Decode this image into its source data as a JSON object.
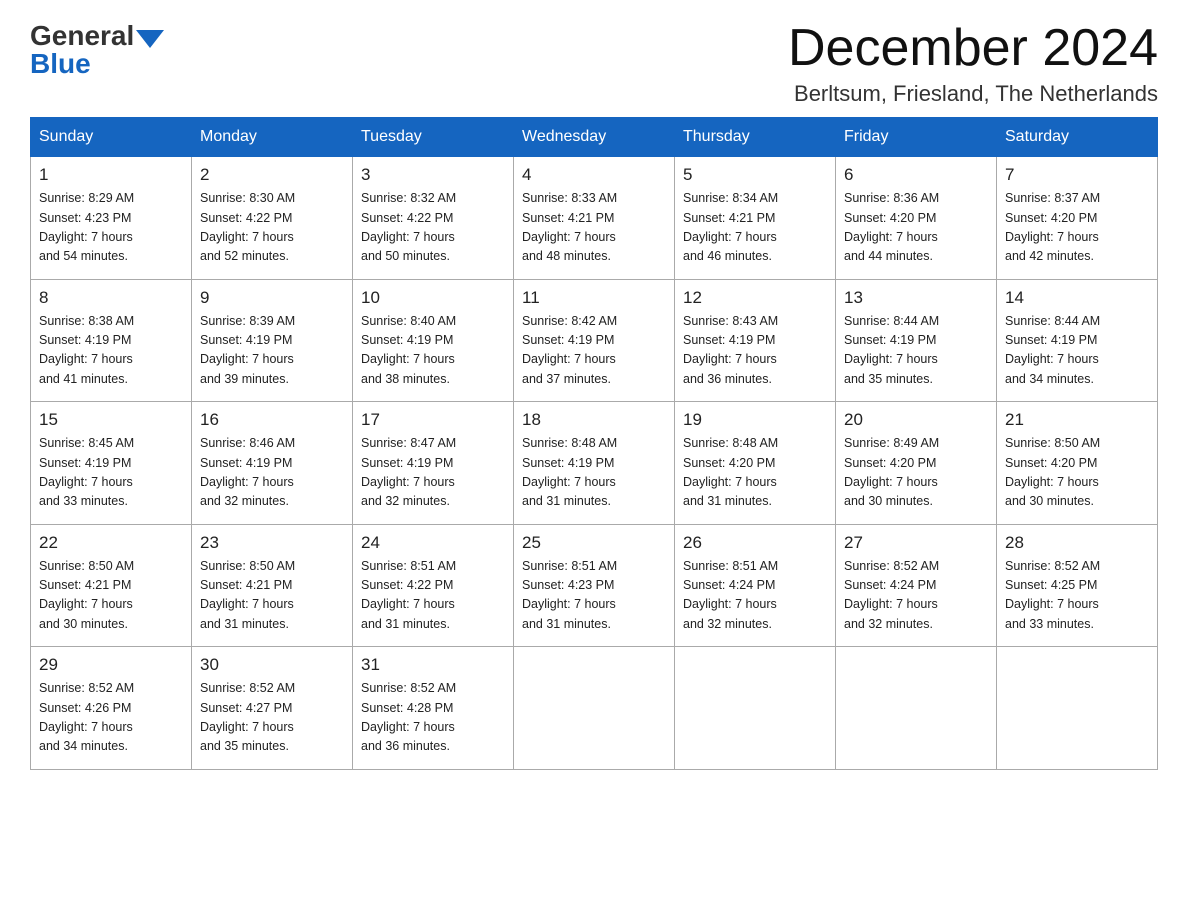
{
  "header": {
    "logo_general": "General",
    "logo_blue": "Blue",
    "month_title": "December 2024",
    "location": "Berltsum, Friesland, The Netherlands"
  },
  "days_of_week": [
    "Sunday",
    "Monday",
    "Tuesday",
    "Wednesday",
    "Thursday",
    "Friday",
    "Saturday"
  ],
  "weeks": [
    [
      {
        "day": "1",
        "sunrise": "8:29 AM",
        "sunset": "4:23 PM",
        "daylight": "7 hours and 54 minutes."
      },
      {
        "day": "2",
        "sunrise": "8:30 AM",
        "sunset": "4:22 PM",
        "daylight": "7 hours and 52 minutes."
      },
      {
        "day": "3",
        "sunrise": "8:32 AM",
        "sunset": "4:22 PM",
        "daylight": "7 hours and 50 minutes."
      },
      {
        "day": "4",
        "sunrise": "8:33 AM",
        "sunset": "4:21 PM",
        "daylight": "7 hours and 48 minutes."
      },
      {
        "day": "5",
        "sunrise": "8:34 AM",
        "sunset": "4:21 PM",
        "daylight": "7 hours and 46 minutes."
      },
      {
        "day": "6",
        "sunrise": "8:36 AM",
        "sunset": "4:20 PM",
        "daylight": "7 hours and 44 minutes."
      },
      {
        "day": "7",
        "sunrise": "8:37 AM",
        "sunset": "4:20 PM",
        "daylight": "7 hours and 42 minutes."
      }
    ],
    [
      {
        "day": "8",
        "sunrise": "8:38 AM",
        "sunset": "4:19 PM",
        "daylight": "7 hours and 41 minutes."
      },
      {
        "day": "9",
        "sunrise": "8:39 AM",
        "sunset": "4:19 PM",
        "daylight": "7 hours and 39 minutes."
      },
      {
        "day": "10",
        "sunrise": "8:40 AM",
        "sunset": "4:19 PM",
        "daylight": "7 hours and 38 minutes."
      },
      {
        "day": "11",
        "sunrise": "8:42 AM",
        "sunset": "4:19 PM",
        "daylight": "7 hours and 37 minutes."
      },
      {
        "day": "12",
        "sunrise": "8:43 AM",
        "sunset": "4:19 PM",
        "daylight": "7 hours and 36 minutes."
      },
      {
        "day": "13",
        "sunrise": "8:44 AM",
        "sunset": "4:19 PM",
        "daylight": "7 hours and 35 minutes."
      },
      {
        "day": "14",
        "sunrise": "8:44 AM",
        "sunset": "4:19 PM",
        "daylight": "7 hours and 34 minutes."
      }
    ],
    [
      {
        "day": "15",
        "sunrise": "8:45 AM",
        "sunset": "4:19 PM",
        "daylight": "7 hours and 33 minutes."
      },
      {
        "day": "16",
        "sunrise": "8:46 AM",
        "sunset": "4:19 PM",
        "daylight": "7 hours and 32 minutes."
      },
      {
        "day": "17",
        "sunrise": "8:47 AM",
        "sunset": "4:19 PM",
        "daylight": "7 hours and 32 minutes."
      },
      {
        "day": "18",
        "sunrise": "8:48 AM",
        "sunset": "4:19 PM",
        "daylight": "7 hours and 31 minutes."
      },
      {
        "day": "19",
        "sunrise": "8:48 AM",
        "sunset": "4:20 PM",
        "daylight": "7 hours and 31 minutes."
      },
      {
        "day": "20",
        "sunrise": "8:49 AM",
        "sunset": "4:20 PM",
        "daylight": "7 hours and 30 minutes."
      },
      {
        "day": "21",
        "sunrise": "8:50 AM",
        "sunset": "4:20 PM",
        "daylight": "7 hours and 30 minutes."
      }
    ],
    [
      {
        "day": "22",
        "sunrise": "8:50 AM",
        "sunset": "4:21 PM",
        "daylight": "7 hours and 30 minutes."
      },
      {
        "day": "23",
        "sunrise": "8:50 AM",
        "sunset": "4:21 PM",
        "daylight": "7 hours and 31 minutes."
      },
      {
        "day": "24",
        "sunrise": "8:51 AM",
        "sunset": "4:22 PM",
        "daylight": "7 hours and 31 minutes."
      },
      {
        "day": "25",
        "sunrise": "8:51 AM",
        "sunset": "4:23 PM",
        "daylight": "7 hours and 31 minutes."
      },
      {
        "day": "26",
        "sunrise": "8:51 AM",
        "sunset": "4:24 PM",
        "daylight": "7 hours and 32 minutes."
      },
      {
        "day": "27",
        "sunrise": "8:52 AM",
        "sunset": "4:24 PM",
        "daylight": "7 hours and 32 minutes."
      },
      {
        "day": "28",
        "sunrise": "8:52 AM",
        "sunset": "4:25 PM",
        "daylight": "7 hours and 33 minutes."
      }
    ],
    [
      {
        "day": "29",
        "sunrise": "8:52 AM",
        "sunset": "4:26 PM",
        "daylight": "7 hours and 34 minutes."
      },
      {
        "day": "30",
        "sunrise": "8:52 AM",
        "sunset": "4:27 PM",
        "daylight": "7 hours and 35 minutes."
      },
      {
        "day": "31",
        "sunrise": "8:52 AM",
        "sunset": "4:28 PM",
        "daylight": "7 hours and 36 minutes."
      },
      null,
      null,
      null,
      null
    ]
  ],
  "labels": {
    "sunrise": "Sunrise:",
    "sunset": "Sunset:",
    "daylight": "Daylight:"
  }
}
